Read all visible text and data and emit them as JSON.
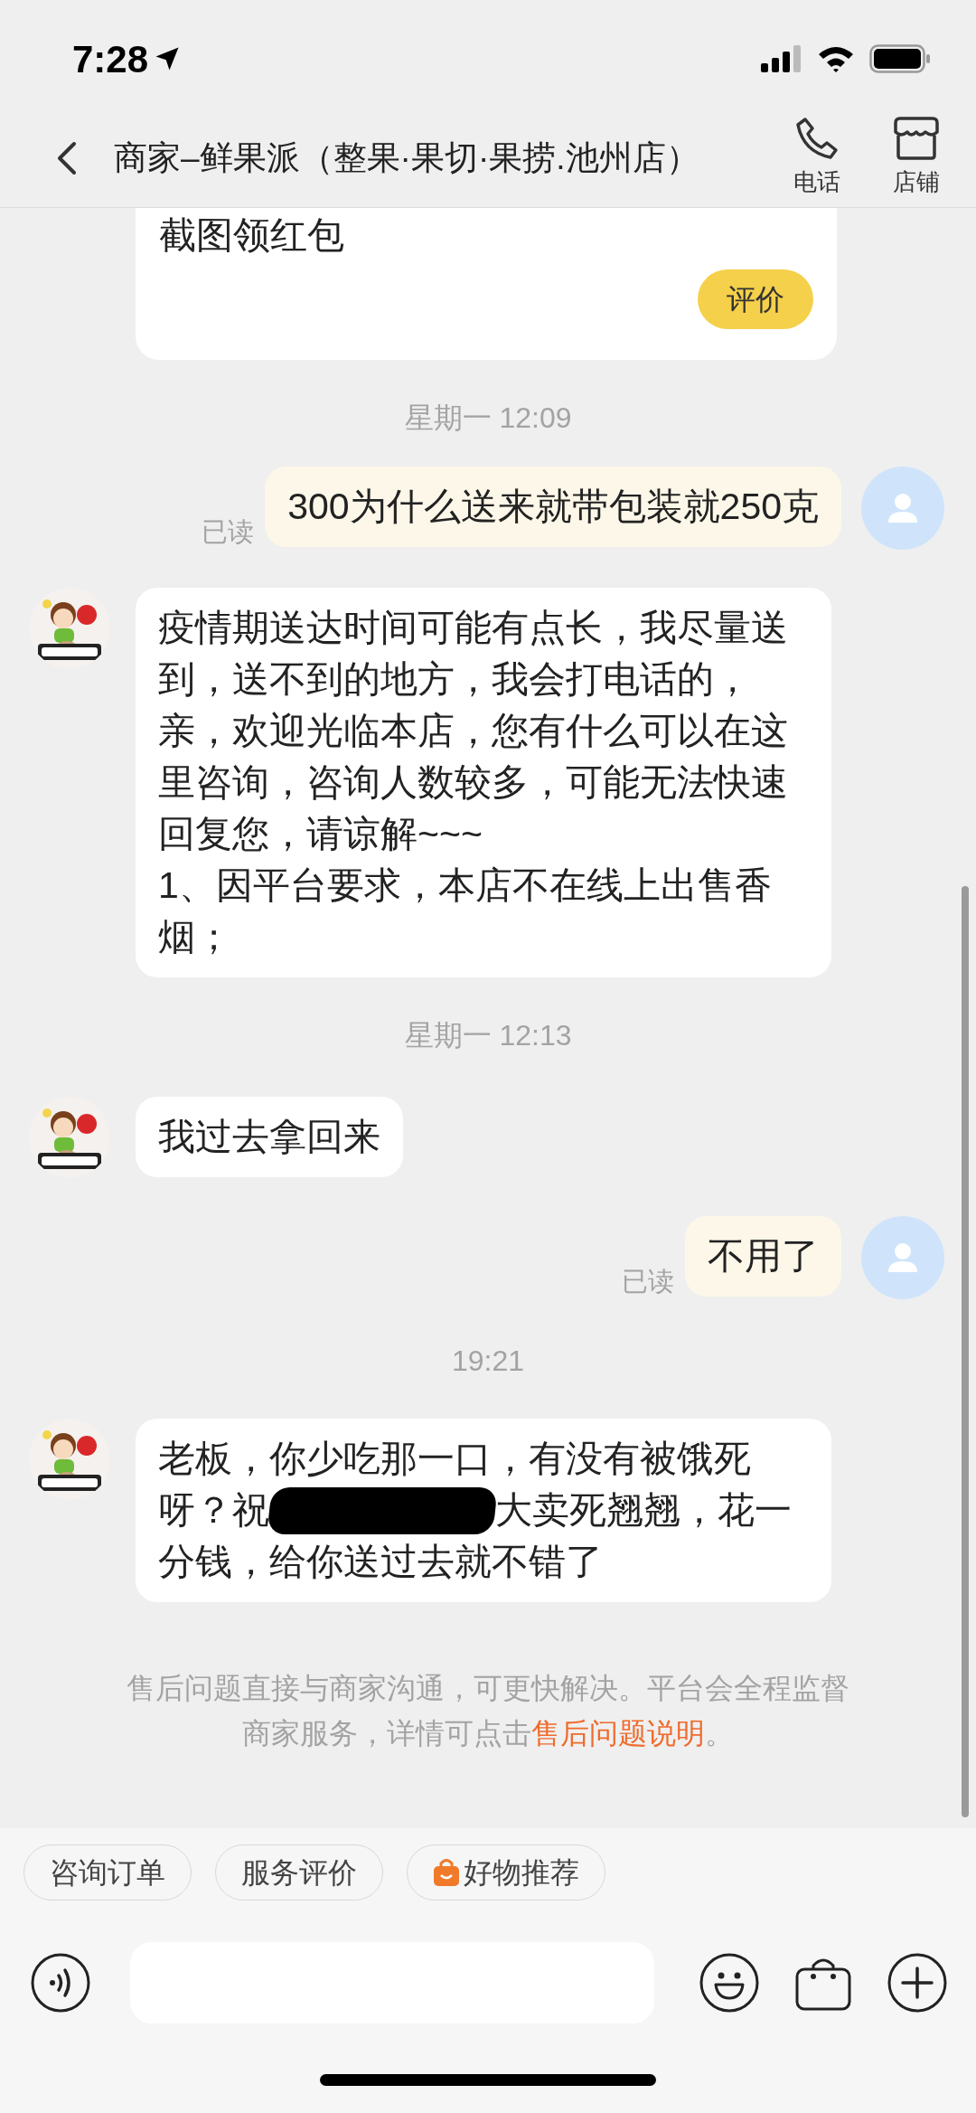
{
  "status_bar": {
    "time": "7:28"
  },
  "header": {
    "title": "商家–鲜果派（整果·果切·果捞.池州店）",
    "actions": [
      {
        "kind": "phone",
        "label": "电话"
      },
      {
        "kind": "store",
        "label": "店铺"
      }
    ]
  },
  "messages": [
    {
      "kind": "card",
      "text": "截图领红包",
      "button": "评价"
    },
    {
      "kind": "time",
      "text": "星期一 12:09"
    },
    {
      "kind": "out",
      "text": "300为什么送来就带包装就250克",
      "status": "已读"
    },
    {
      "kind": "in",
      "paragraphs": [
        "疫情期送达时间可能有点长，我尽量送到，送不到的地方，我会打电话的，",
        "亲，欢迎光临本店，您有什么可以在这里咨询，咨询人数较多，可能无法快速回复您，请谅解~~~",
        "1、因平台要求，本店不在线上出售香烟；"
      ]
    },
    {
      "kind": "time",
      "text": "星期一 12:13"
    },
    {
      "kind": "in",
      "paragraphs": [
        "我过去拿回来"
      ]
    },
    {
      "kind": "out",
      "text": "不用了",
      "status": "已读"
    },
    {
      "kind": "time",
      "text": "19:21"
    },
    {
      "kind": "in_redacted",
      "lines": [
        {
          "text": "老板，你少吃那一口，有没有被饿死"
        },
        {
          "before": "呀？祝",
          "after": "大卖死翘翘，花一"
        },
        {
          "text": "分钱，给你送过去就不错了"
        }
      ]
    },
    {
      "kind": "notice",
      "text": "售后问题直接与商家沟通，可更快解决。平台会全程监督商家服务，详情可点击",
      "link": "售后问题说明",
      "end": "。"
    }
  ],
  "quick_replies": [
    {
      "label": "咨询订单",
      "icon": false
    },
    {
      "label": "服务评价",
      "icon": false
    },
    {
      "label": "好物推荐",
      "icon": true
    }
  ]
}
